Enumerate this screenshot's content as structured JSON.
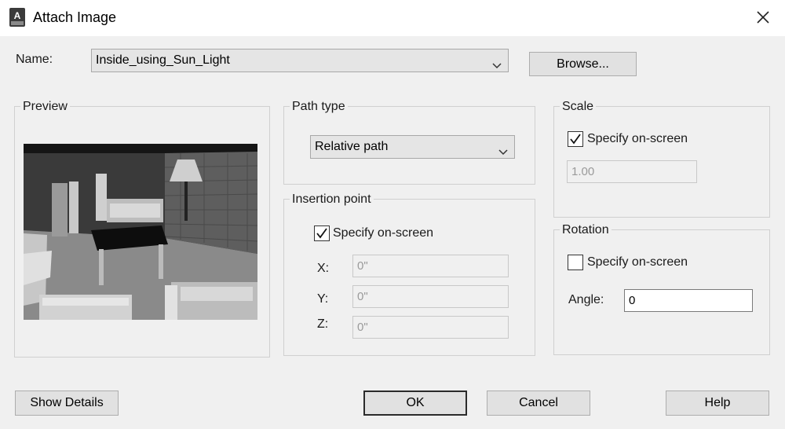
{
  "window": {
    "title": "Attach Image"
  },
  "name_row": {
    "label": "Name:",
    "value": "Inside_using_Sun_Light",
    "browse_label": "Browse..."
  },
  "preview": {
    "title": "Preview"
  },
  "path_type": {
    "title": "Path type",
    "value": "Relative path"
  },
  "insertion_point": {
    "title": "Insertion point",
    "specify_label": "Specify on-screen",
    "specify_checked": true,
    "x_label": "X:",
    "x_value": "0\"",
    "y_label": "Y:",
    "y_value": "0\"",
    "z_label": "Z:",
    "z_value": "0\""
  },
  "scale": {
    "title": "Scale",
    "specify_label": "Specify on-screen",
    "specify_checked": true,
    "value": "1.00"
  },
  "rotation": {
    "title": "Rotation",
    "specify_label": "Specify on-screen",
    "specify_checked": false,
    "angle_label": "Angle:",
    "angle_value": "0"
  },
  "buttons": {
    "show_details": "Show Details",
    "ok": "OK",
    "cancel": "Cancel",
    "help": "Help"
  },
  "icons": {
    "app": "autocad-app-icon",
    "close": "close-icon",
    "chevron": "chevron-down-icon",
    "check": "checkmark-icon"
  }
}
